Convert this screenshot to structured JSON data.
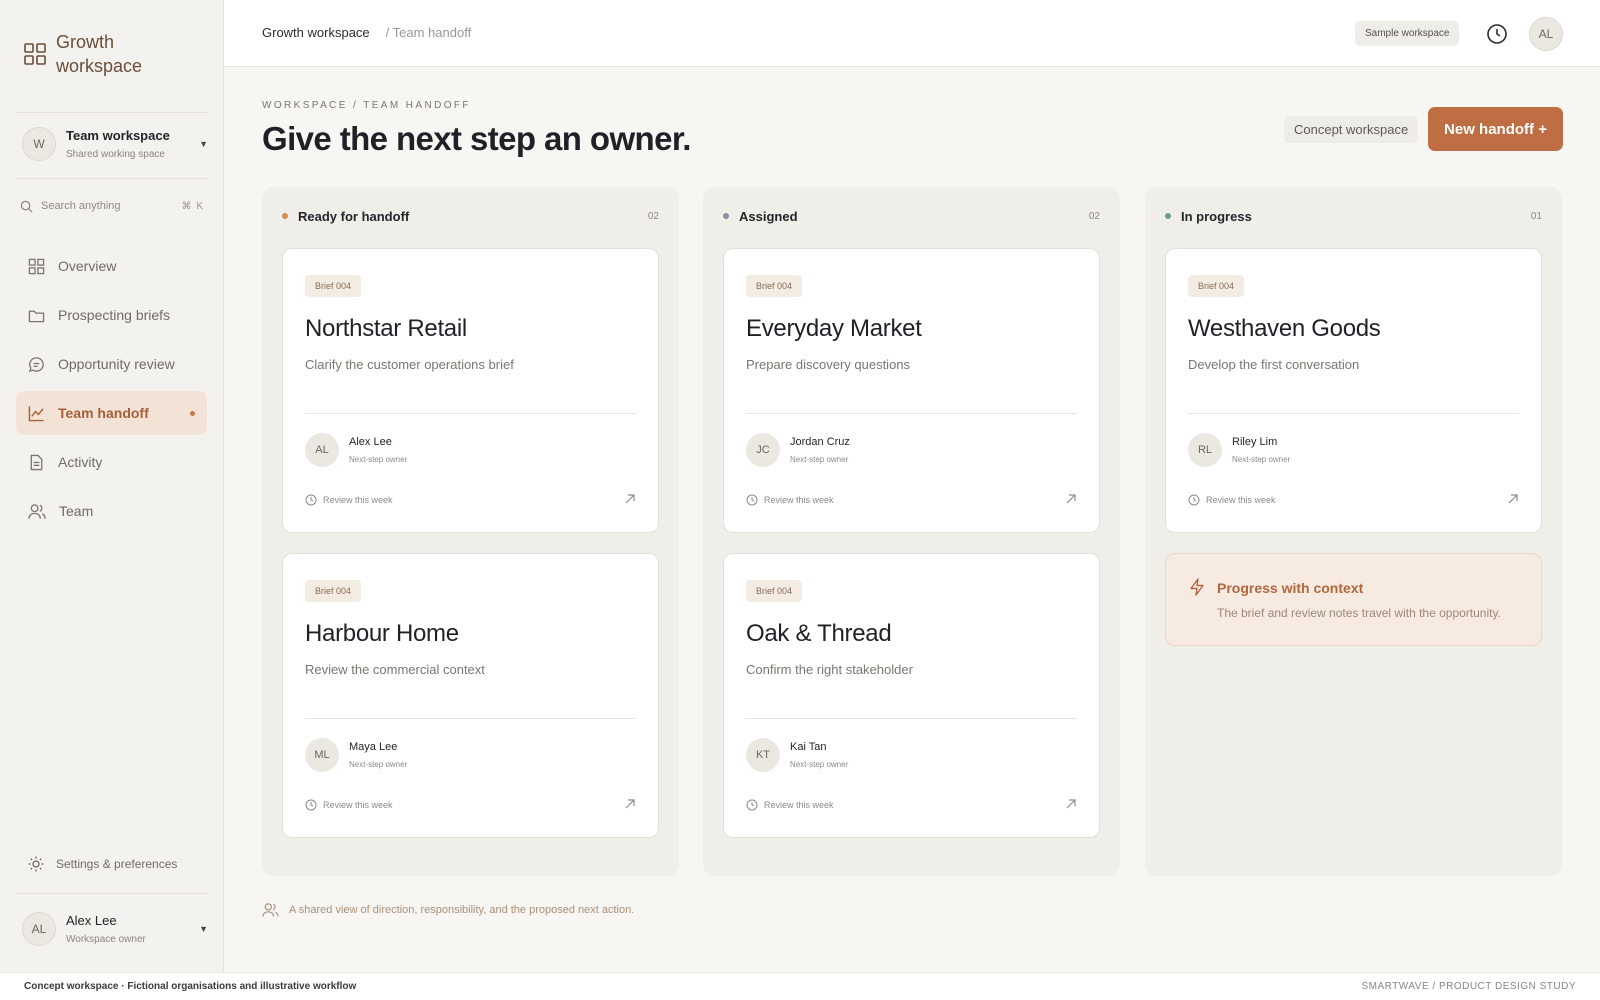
{
  "brand": {
    "title": "Growth workspace",
    "icon": "grid-icon"
  },
  "workspace_switcher": {
    "initial": "W",
    "name": "Team workspace",
    "subtitle": "Shared working space"
  },
  "search": {
    "placeholder": "Search anything",
    "shortcut": "⌘ K"
  },
  "sidebar": {
    "items": [
      {
        "label": "Overview",
        "icon": "overview-grid-icon",
        "active": false
      },
      {
        "label": "Prospecting briefs",
        "icon": "folder-icon",
        "active": false
      },
      {
        "label": "Opportunity review",
        "icon": "chat-bubble-icon",
        "active": false
      },
      {
        "label": "Team handoff",
        "icon": "line-chart-icon",
        "active": true
      },
      {
        "label": "Activity",
        "icon": "document-icon",
        "active": false
      },
      {
        "label": "Team",
        "icon": "users-icon",
        "active": false
      }
    ],
    "settings": "Settings & preferences"
  },
  "user": {
    "initials": "AL",
    "name": "Alex Lee",
    "role": "Workspace owner"
  },
  "topbar": {
    "breadcrumb_root": "Growth workspace",
    "breadcrumb_current": "/ Team handoff",
    "badge": "Sample workspace",
    "avatar": "AL"
  },
  "header": {
    "eyebrow": "WORKSPACE / TEAM HANDOFF",
    "title": "Give the next step an owner.",
    "concept_badge": "Concept workspace",
    "new_button": "New handoff +"
  },
  "columns": [
    {
      "name": "Ready for handoff",
      "count": "02",
      "color": "#cf8a5e",
      "cards": [
        {
          "brief": "Brief 004",
          "title": "Northstar Retail",
          "desc": "Clarify the customer operations brief",
          "initials": "AL",
          "owner": "Alex Lee",
          "role": "Next-step owner",
          "review": "Review this week"
        },
        {
          "brief": "Brief 004",
          "title": "Harbour Home",
          "desc": "Review the commercial context",
          "initials": "ML",
          "owner": "Maya Lee",
          "role": "Next-step owner",
          "review": "Review this week"
        }
      ]
    },
    {
      "name": "Assigned",
      "count": "02",
      "color": "#8c8ba0",
      "cards": [
        {
          "brief": "Brief 004",
          "title": "Everyday Market",
          "desc": "Prepare discovery questions",
          "initials": "JC",
          "owner": "Jordan Cruz",
          "role": "Next-step owner",
          "review": "Review this week"
        },
        {
          "brief": "Brief 004",
          "title": "Oak & Thread",
          "desc": "Confirm the right stakeholder",
          "initials": "KT",
          "owner": "Kai Tan",
          "role": "Next-step owner",
          "review": "Review this week"
        }
      ]
    },
    {
      "name": "In progress",
      "count": "01",
      "color": "#6f9a84",
      "cards": [
        {
          "brief": "Brief 004",
          "title": "Westhaven Goods",
          "desc": "Develop the first conversation",
          "initials": "RL",
          "owner": "Riley Lim",
          "role": "Next-step owner",
          "review": "Review this week"
        }
      ],
      "note": {
        "title": "Progress with context",
        "text": "The brief and review notes travel with the opportunity."
      }
    }
  ],
  "footer_note": "A shared view of direction, responsibility, and the proposed next action.",
  "bottom_bar": {
    "left": "Concept workspace · Fictional organisations and illustrative workflow",
    "right": "SMARTWAVE / PRODUCT DESIGN STUDY"
  },
  "colors": {
    "accent": "#bf6e43",
    "accent_soft": "#f3e3d6",
    "sidebar_bg": "#f4f2ee",
    "column_bg": "#f0eee9"
  }
}
